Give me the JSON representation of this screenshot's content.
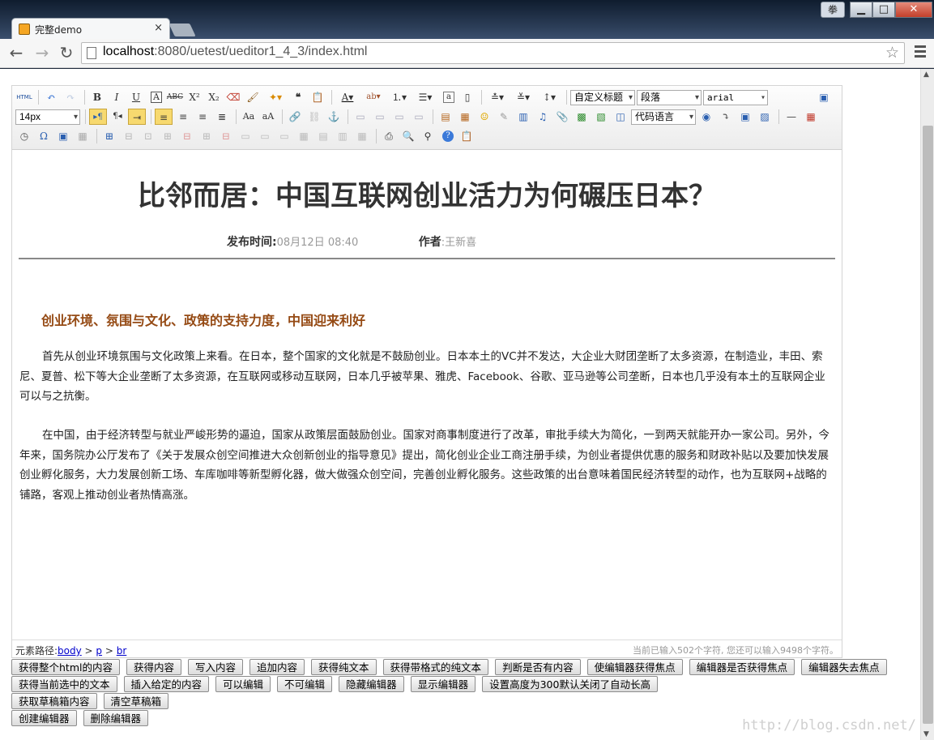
{
  "browser": {
    "tab_title": "完整demo",
    "tab_close": "×",
    "url_host": "localhost",
    "url_rest": ":8080/uetest/ueditor1_4_3/index.html",
    "ime_label": "拳",
    "min_label": "▁",
    "max_label": "□",
    "close_label": "✕",
    "back": "←",
    "forward": "→",
    "reload": "↻",
    "star": "☆"
  },
  "toolbar": {
    "html_label": "HTML",
    "heading_combo": "自定义标题",
    "paragraph_combo": "段落",
    "font_combo": "arial",
    "size_combo": "14px",
    "codelang_combo": "代码语言"
  },
  "article": {
    "title": "比邻而居：中国互联网创业活力为何碾压日本？",
    "publish_label": "发布时间:",
    "publish_time": "08月12日 08:40",
    "author_label": "作者",
    "author_name": ":王新喜",
    "subtitle": "创业环境、氛围与文化、政策的支持力度，中国迎来利好",
    "p1": "首先从创业环境氛围与文化政策上来看。在日本，整个国家的文化就是不鼓励创业。日本本土的VC并不发达，大企业大财团垄断了太多资源，在制造业，丰田、索尼、夏普、松下等大企业垄断了太多资源，在互联网或移动互联网，日本几乎被苹果、雅虎、Facebook、谷歌、亚马逊等公司垄断，日本也几乎没有本土的互联网企业可以与之抗衡。",
    "p2": "在中国，由于经济转型与就业严峻形势的逼迫，国家从政策层面鼓励创业。国家对商事制度进行了改革，审批手续大为简化，一到两天就能开办一家公司。另外，今年来，国务院办公厅发布了《关于发展众创空间推进大众创新创业的指导意见》提出，简化创业企业工商注册手续，为创业者提供优惠的服务和财政补贴以及要加快发展创业孵化服务，大力发展创新工场、车库咖啡等新型孵化器，做大做强众创空间，完善创业孵化服务。这些政策的出台意味着国民经济转型的动作，也为互联网+战略的铺路，客观上推动创业者热情高涨。"
  },
  "status": {
    "path_label": "元素路径:",
    "path_body": "body",
    "path_sep1": " > ",
    "path_p": "p",
    "path_sep2": " > ",
    "path_br": "br",
    "count": "当前已输入502个字符, 您还可以输入9498个字符。"
  },
  "buttons": {
    "row1": [
      "获得整个html的内容",
      "获得内容",
      "写入内容",
      "追加内容",
      "获得纯文本",
      "获得带格式的纯文本",
      "判断是否有内容",
      "使编辑器获得焦点",
      "编辑器是否获得焦点",
      "编辑器失去焦点"
    ],
    "row2": [
      "获得当前选中的文本",
      "插入给定的内容",
      "可以编辑",
      "不可编辑",
      "隐藏编辑器",
      "显示编辑器",
      "设置高度为300默认关闭了自动长高"
    ],
    "row3": [
      "获取草稿箱内容",
      "清空草稿箱"
    ],
    "row4": [
      "创建编辑器",
      "删除编辑器"
    ]
  },
  "watermark": "http://blog.csdn.net/"
}
